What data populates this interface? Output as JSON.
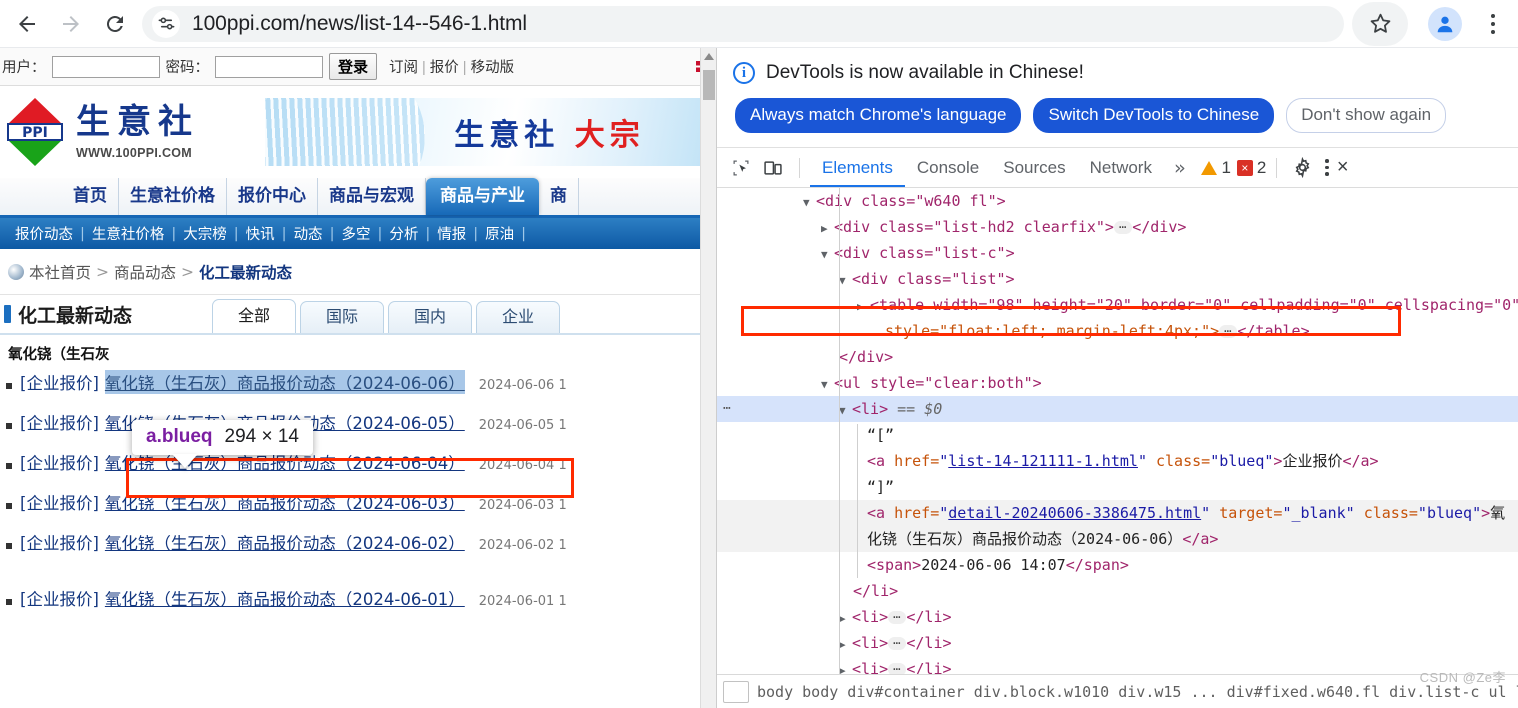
{
  "browser": {
    "back_label": "Back",
    "forward_label": "Forward",
    "reload_label": "Reload",
    "url": "100ppi.com/news/list-14--546-1.html",
    "site_settings_label": "View site information",
    "bookmark_label": "Bookmark this tab",
    "profile_label": "Profile",
    "menu_label": "Customize and control Google Chrome"
  },
  "site": {
    "topbar": {
      "user_label": "用户：",
      "user_value": "",
      "password_label": "密码：",
      "password_value": "",
      "login_button": "登录",
      "links": [
        "订阅",
        "报价",
        "移动版"
      ]
    },
    "logo": {
      "brand_cn": "生意社",
      "brand_url": "WWW.100PPI.COM",
      "mark_text": "PPI"
    },
    "banner": {
      "text_blue": "生意社",
      "text_red": "大宗"
    },
    "main_nav": [
      {
        "label": "首页",
        "active": false
      },
      {
        "label": "生意社价格",
        "active": false
      },
      {
        "label": "报价中心",
        "active": false
      },
      {
        "label": "商品与宏观",
        "active": false
      },
      {
        "label": "商品与产业",
        "active": true
      },
      {
        "label": "商",
        "active": false
      }
    ],
    "sub_nav": [
      "报价动态",
      "生意社价格",
      "大宗榜",
      "快讯",
      "动态",
      "多空",
      "分析",
      "情报",
      "原油"
    ],
    "breadcrumb": [
      "本社首页",
      "商品动态",
      "化工最新动态"
    ],
    "section": {
      "title": "化工最新动态",
      "tabs": [
        {
          "label": "全部",
          "active": true
        },
        {
          "label": "国际",
          "active": false
        },
        {
          "label": "国内",
          "active": false
        },
        {
          "label": "企业",
          "active": false
        }
      ]
    },
    "list_heading": "氧化铙（生石灰",
    "news": [
      {
        "tag": "企业报价",
        "title": "氧化铙（生石灰）商品报价动态（2024-06-06）",
        "time": "2024-06-06 1",
        "selected": true
      },
      {
        "tag": "企业报价",
        "title": "氧化铙（生石灰）商品报价动态（2024-06-05）",
        "time": "2024-06-05 1",
        "selected": false
      },
      {
        "tag": "企业报价",
        "title": "氧化铙（生石灰）商品报价动态（2024-06-04）",
        "time": "2024-06-04 1",
        "selected": false
      },
      {
        "tag": "企业报价",
        "title": "氧化铙（生石灰）商品报价动态（2024-06-03）",
        "time": "2024-06-03 1",
        "selected": false
      },
      {
        "tag": "企业报价",
        "title": "氧化铙（生石灰）商品报价动态（2024-06-02）",
        "time": "2024-06-02 1",
        "selected": false
      },
      {
        "tag": "企业报价",
        "title": "氧化铙（生石灰）商品报价动态（2024-06-01）",
        "time": "2024-06-01 1",
        "selected": false
      }
    ]
  },
  "inspector_tooltip": {
    "selector": "a.blueq",
    "dimensions": "294 × 14"
  },
  "devtools": {
    "infobar": {
      "message": "DevTools is now available in Chinese!",
      "buttons": [
        {
          "label": "Always match Chrome's language",
          "style": "primary"
        },
        {
          "label": "Switch DevTools to Chinese",
          "style": "primary"
        },
        {
          "label": "Don't show again",
          "style": "ghost"
        }
      ]
    },
    "tabs": [
      {
        "label": "Elements",
        "active": true
      },
      {
        "label": "Console",
        "active": false
      },
      {
        "label": "Sources",
        "active": false
      },
      {
        "label": "Network",
        "active": false
      }
    ],
    "more_tabs_label": "»",
    "warning_count": "1",
    "error_count": "2",
    "error_mark": "×",
    "close_label": "×",
    "dom": {
      "l1": "<div class=\"w640 fl\">",
      "l2": "<div class=\"list-hd2 clearfix\">",
      "l2_end": "</div>",
      "l3": "<div class=\"list-c\">",
      "l4": "<div class=\"list\">",
      "l5": "<table width=\"98\" height=\"20\" border=\"0\" cellpadding=\"0\" cellspacing=\"0\"",
      "l6": "style=\"float:left; margin-left:4px;\">",
      "l6_end": "</table>",
      "l7": "</div>",
      "l8": "<ul style=\"clear:both\">",
      "l9": "<li>",
      "l9_marker": "== $0",
      "l10": "“[”",
      "l11_href": "list-14-121111-1.html",
      "l11_class": "blueq",
      "l11_text": "企业报价",
      "l12": "“]”",
      "l13_href": "detail-20240606-3386475.html",
      "l13_target": "_blank",
      "l13_class": "blueq",
      "l13_text_part1": "氧",
      "l14_text": "化铙（生石灰）商品报价动态（2024-06-06）",
      "l15_span": "2024-06-06 14:07",
      "l16": "</li>",
      "l17": "<li>",
      "l18": "<li>",
      "l19": "<li>"
    },
    "breadcrumb_strip": "body   body   div#container   div.block.w1010   div.w15   ...   div#fixed.w640.fl   div.list-c   ul   li"
  },
  "watermark": "CSDN @Ze李"
}
